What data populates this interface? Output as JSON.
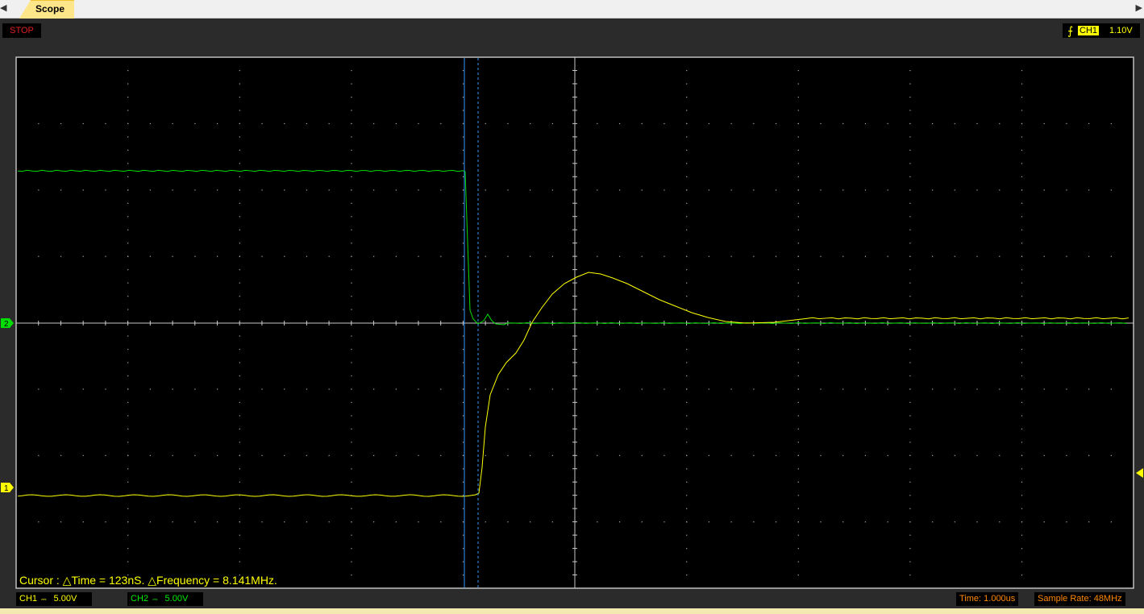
{
  "tab": {
    "label": "Scope"
  },
  "status": {
    "run_state": "STOP"
  },
  "trigger": {
    "channel": "CH1",
    "level": "1.10V",
    "edge_icon": "rising-edge-icon"
  },
  "markers": {
    "ch2": "2",
    "ch1": "1"
  },
  "cursor": {
    "readout": "Cursor : △Time = 123nS. △Frequency = 8.141MHz."
  },
  "channels": [
    {
      "name": "CH1",
      "coupling": "DC",
      "scale": "5.00V",
      "color": "#ffff00"
    },
    {
      "name": "CH2",
      "coupling": "DC",
      "scale": "5.00V",
      "color": "#00dd00"
    }
  ],
  "timebase": {
    "label": "Time: 1.000us"
  },
  "sample_rate": {
    "label": "Sample Rate: 48MHz"
  },
  "colors": {
    "grid": "#c0c0c0",
    "cursor": "#3399ff",
    "ch1": "#ffff00",
    "ch2": "#00dd00",
    "status": "#e02020",
    "info": "#ff8800"
  }
}
